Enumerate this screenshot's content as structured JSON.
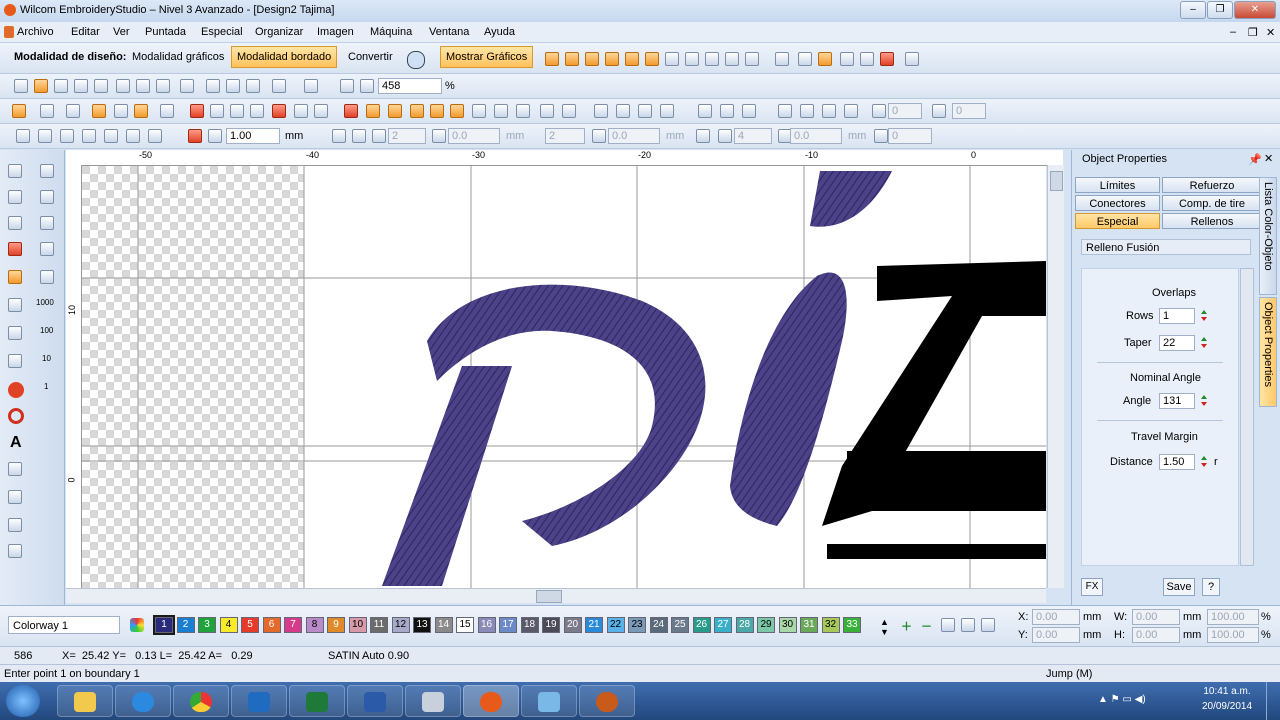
{
  "window": {
    "title": "Wilcom EmbroideryStudio – Nivel 3 Avanzado - [Design2        Tajima]"
  },
  "menu": [
    "Archivo",
    "Editar",
    "Ver",
    "Puntada",
    "Especial",
    "Organizar",
    "Imagen",
    "Máquina",
    "Ventana",
    "Ayuda"
  ],
  "mode_toolbar": {
    "label": "Modalidad de diseño:",
    "graphics": "Modalidad gráficos",
    "embroidery": "Modalidad bordado",
    "convert": "Convertir",
    "show_graphics": "Mostrar Gráficos"
  },
  "zoom": {
    "value": "458",
    "unit": "%"
  },
  "toolbar3": {
    "scale_value": "1.00",
    "unit": "mm"
  },
  "toolbar_disabled": {
    "v1": "0",
    "v2": "0",
    "v3": "2",
    "v4": "0.0",
    "unit_mm": "mm",
    "v5": "2",
    "v6": "0.0",
    "v7": "4",
    "v8": "0.0",
    "v9": "0"
  },
  "ruler": {
    "top": [
      "-50",
      "-40",
      "-30",
      "-20",
      "-10",
      "0"
    ],
    "left": [
      "10",
      "0"
    ]
  },
  "object_properties": {
    "title": "Object Properties",
    "tabs": [
      "Límites",
      "Refuerzo",
      "Conectores",
      "Comp. de tire",
      "Especial",
      "Rellenos"
    ],
    "selected_tab": "Especial",
    "fill_type": "Relleno Fusión",
    "sections": {
      "overlaps": "Overlaps",
      "rows_label": "Rows",
      "rows": "1",
      "taper_label": "Taper",
      "taper": "22",
      "nominal_angle": "Nominal Angle",
      "angle_label": "Angle",
      "angle": "131",
      "travel_margin": "Travel Margin",
      "distance_label": "Distance",
      "distance": "1.50",
      "distance_unit": "r"
    },
    "buttons": {
      "fx": "FX",
      "save": "Save",
      "help": "?"
    },
    "side_tabs": [
      "Lista Color-Objeto",
      "Object Properties"
    ]
  },
  "colorway": {
    "name": "Colorway 1",
    "swatches": [
      {
        "n": "1",
        "c": "#2a2a7a"
      },
      {
        "n": "2",
        "c": "#1b7fd1"
      },
      {
        "n": "3",
        "c": "#1ea43a"
      },
      {
        "n": "4",
        "c": "#f6ea2a"
      },
      {
        "n": "5",
        "c": "#e63a2a"
      },
      {
        "n": "6",
        "c": "#e36a2a"
      },
      {
        "n": "7",
        "c": "#d63a8a"
      },
      {
        "n": "8",
        "c": "#b88ac8"
      },
      {
        "n": "9",
        "c": "#e08a2a"
      },
      {
        "n": "10",
        "c": "#d89aa8"
      },
      {
        "n": "11",
        "c": "#6b6b6b"
      },
      {
        "n": "12",
        "c": "#a8a8c8"
      },
      {
        "n": "13",
        "c": "#111111"
      },
      {
        "n": "14",
        "c": "#8a8a8a"
      },
      {
        "n": "15",
        "c": "#ffffff"
      },
      {
        "n": "16",
        "c": "#8a8ab8"
      },
      {
        "n": "17",
        "c": "#6a8ac8"
      },
      {
        "n": "18",
        "c": "#5a5a6a"
      },
      {
        "n": "19",
        "c": "#4a4a58"
      },
      {
        "n": "20",
        "c": "#7a7a8a"
      },
      {
        "n": "21",
        "c": "#2a8ad8"
      },
      {
        "n": "22",
        "c": "#5ab0e8"
      },
      {
        "n": "23",
        "c": "#7a9ab8"
      },
      {
        "n": "24",
        "c": "#5a6a7a"
      },
      {
        "n": "25",
        "c": "#6a7a8a"
      },
      {
        "n": "26",
        "c": "#2a9a8a"
      },
      {
        "n": "27",
        "c": "#3ab0c8"
      },
      {
        "n": "28",
        "c": "#4aa8a8"
      },
      {
        "n": "29",
        "c": "#7ac8a8"
      },
      {
        "n": "30",
        "c": "#a8d8a8"
      },
      {
        "n": "31",
        "c": "#6aa85a"
      },
      {
        "n": "32",
        "c": "#a8c85a"
      },
      {
        "n": "33",
        "c": "#3ab03a"
      }
    ]
  },
  "geometry": {
    "x_label": "X:",
    "x": "0.00",
    "y_label": "Y:",
    "y": "0.00",
    "w_label": "W:",
    "w": "0.00",
    "h_label": "H:",
    "h": "0.00",
    "unit": "mm",
    "pct_w": "100.00",
    "pct_h": "100.00",
    "pct": "%"
  },
  "status": {
    "count": "586",
    "coords": "X=  25.42 Y=   0.13 L=  25.42 A=   0.29",
    "stitch": "SATIN Auto  0.90",
    "prompt": "Enter point 1 on boundary 1",
    "mode": "Jump (M)"
  },
  "taskbar": {
    "time": "10:41 a.m.",
    "date": "20/09/2014"
  }
}
